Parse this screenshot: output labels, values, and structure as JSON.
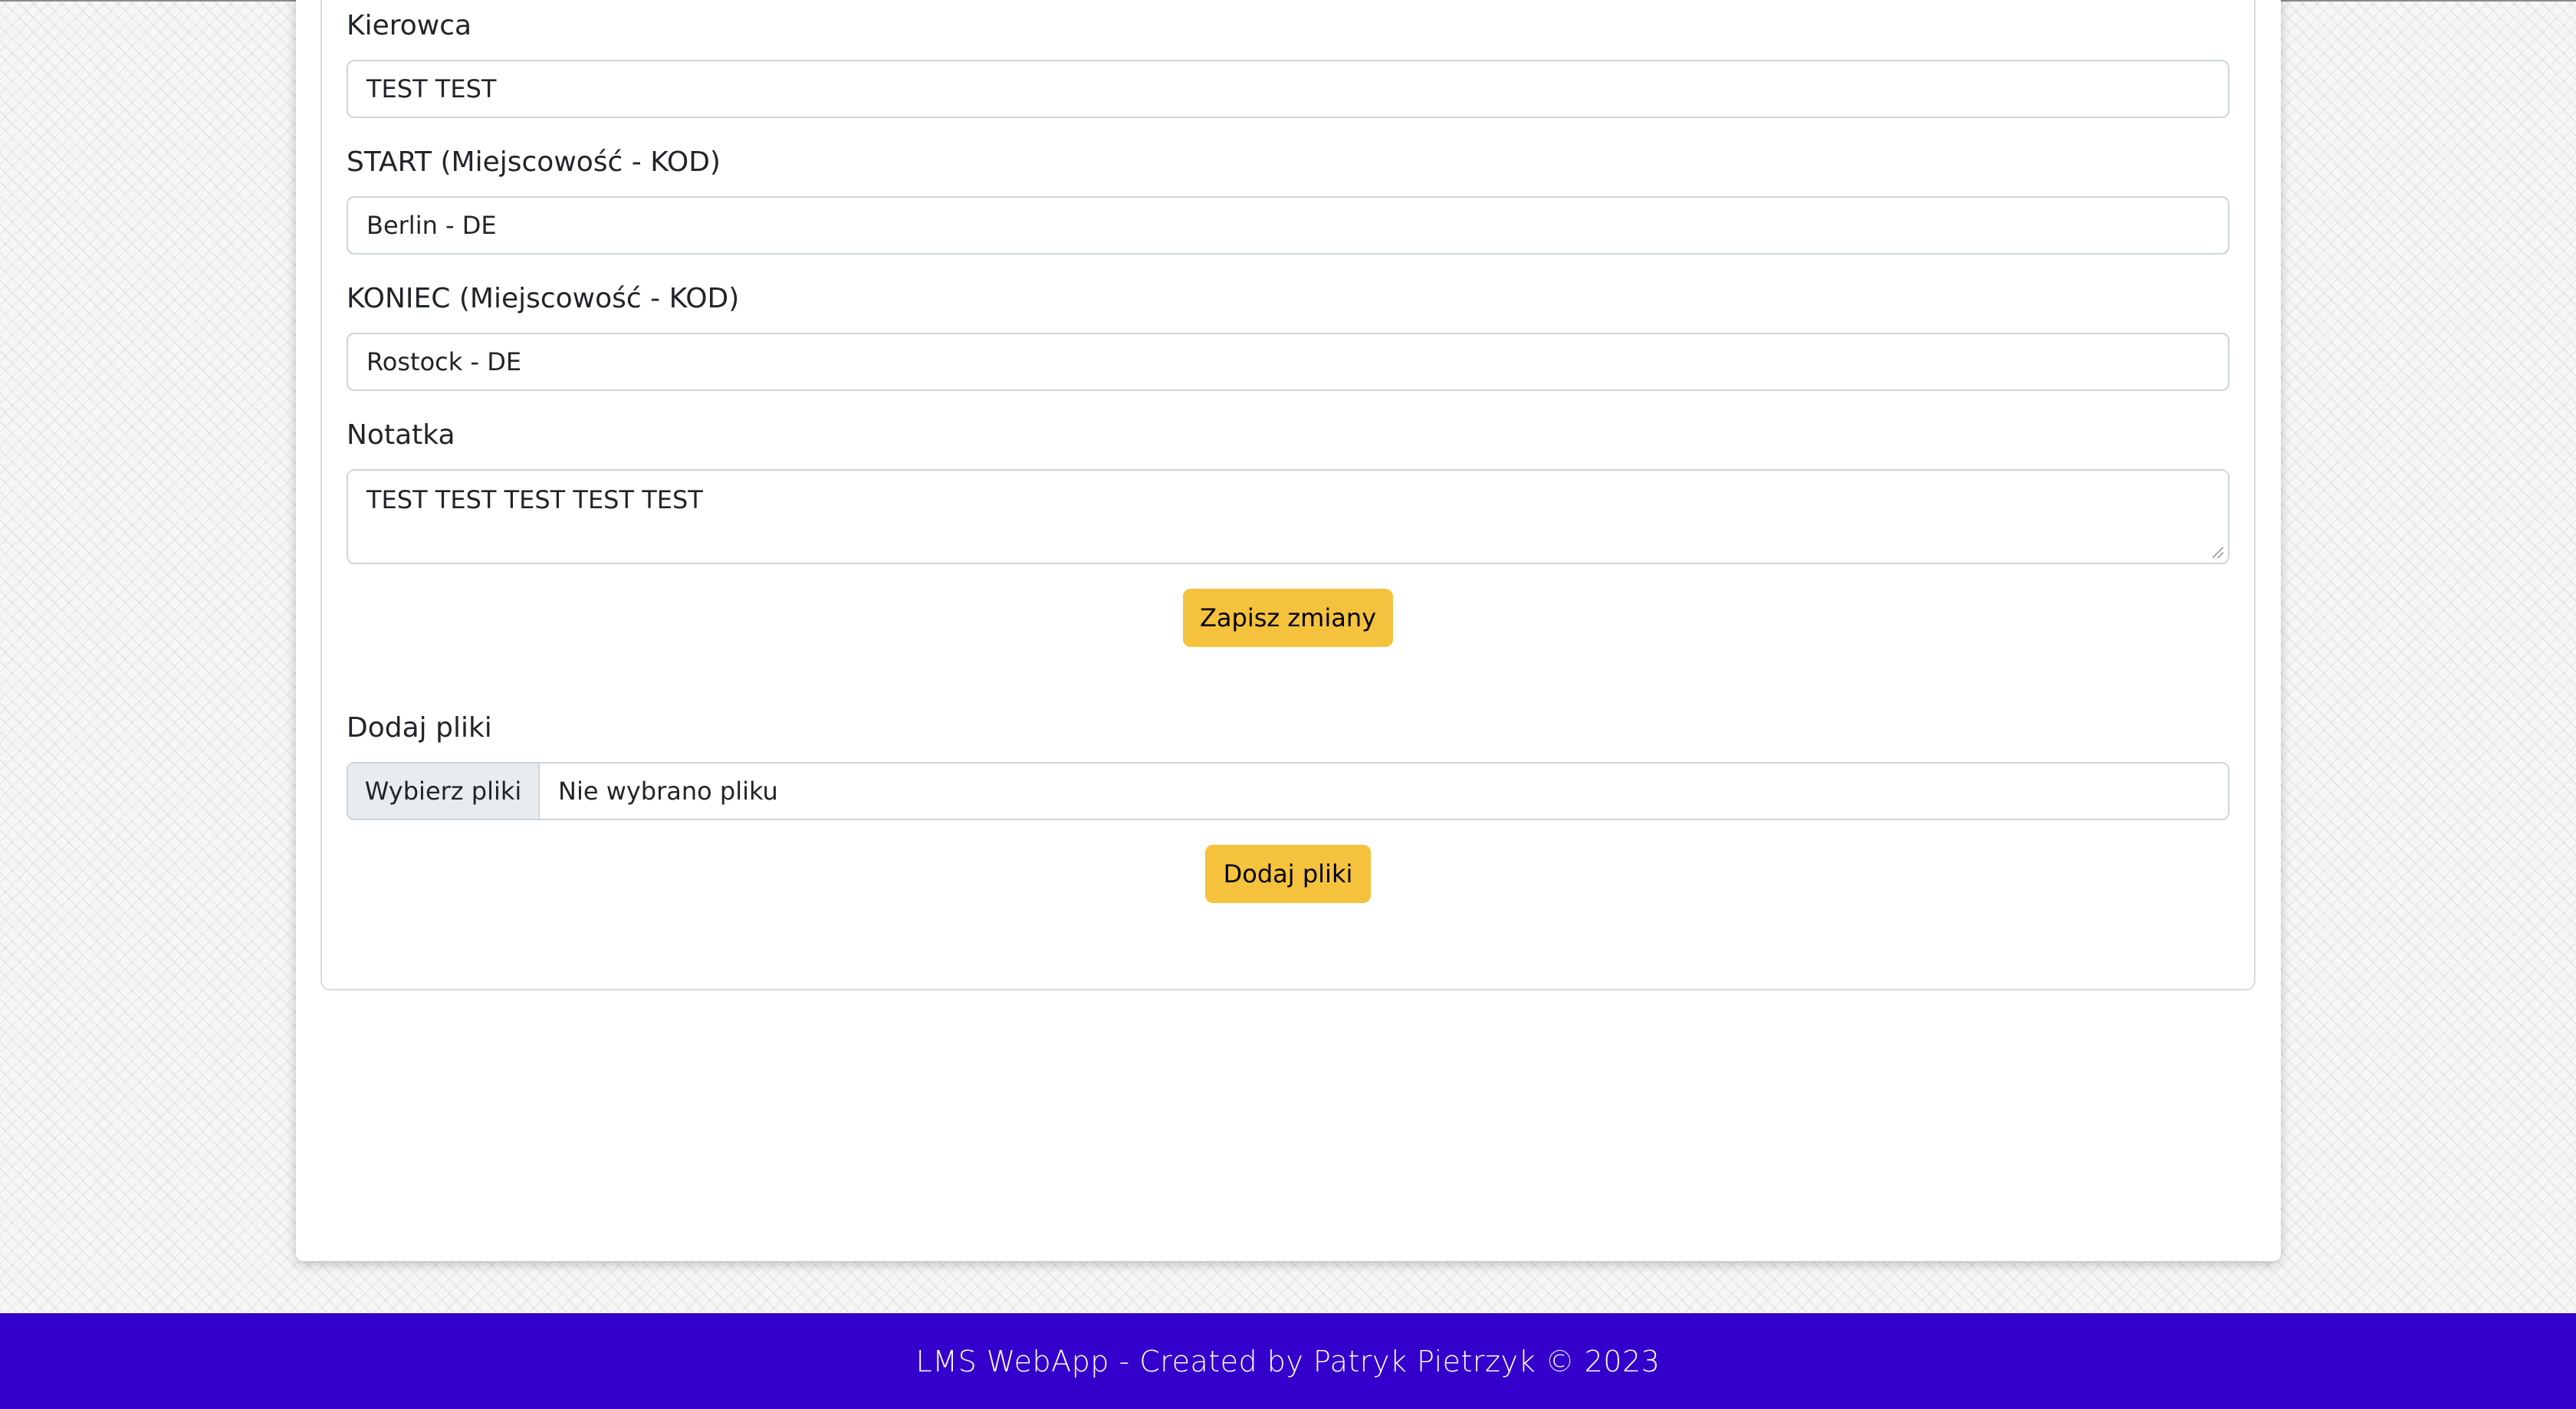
{
  "form": {
    "driver": {
      "label": "Kierowca",
      "value": "TEST TEST"
    },
    "start": {
      "label": "START (Miejscowość - KOD)",
      "value": "Berlin - DE"
    },
    "end": {
      "label": "KONIEC (Miejscowość - KOD)",
      "value": "Rostock - DE"
    },
    "note": {
      "label": "Notatka",
      "value": "TEST TEST TEST TEST TEST"
    },
    "save_label": "Zapisz zmiany"
  },
  "files": {
    "label": "Dodaj pliki",
    "choose_label": "Wybierz pliki",
    "status": "Nie wybrano pliku",
    "submit_label": "Dodaj pliki"
  },
  "footer": {
    "text": "LMS WebApp - Created by Patryk Pietrzyk © 2023"
  },
  "colors": {
    "accent_button": "#f4c23c",
    "footer_bg": "#3300cc"
  }
}
